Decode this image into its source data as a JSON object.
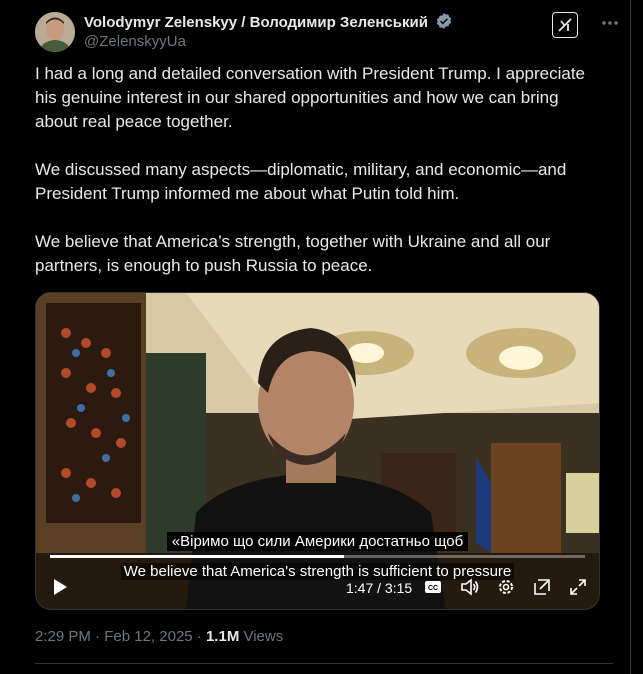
{
  "author": {
    "name": "Volodymyr Zelenskyy / Володимир Зеленський",
    "handle": "@ZelenskyyUa",
    "avatar_icon": "avatar-photo",
    "verified_icon": "verified-badge-icon"
  },
  "header": {
    "grok_icon": "grok-icon",
    "more_icon": "more-horizontal-icon"
  },
  "post": {
    "paragraphs": [
      "I had a long and detailed conversation with President Trump. I appreciate his genuine interest in our shared opportunities and how we can bring about real peace together.",
      "We discussed many aspects—diplomatic, military, and economic—and President Trump informed me about what Putin told him.",
      "We believe that America’s strength, together with Ukraine and all our partners, is enough to push Russia to peace."
    ]
  },
  "video": {
    "subtitle_ua": "«Віримо що сили Америки достатньо щоб",
    "subtitle_en": "We believe that America's strength is sufficient to pressure",
    "time": "1:47 / 3:15",
    "progress": 0.549,
    "icons": [
      "play-icon",
      "captions-icon",
      "volume-icon",
      "settings-icon",
      "popout-icon",
      "fullscreen-icon"
    ]
  },
  "footer": {
    "time": "2:29 PM",
    "separator": " · ",
    "date": "Feb 12, 2025",
    "views_count": "1.1M",
    "views_label": " Views"
  }
}
